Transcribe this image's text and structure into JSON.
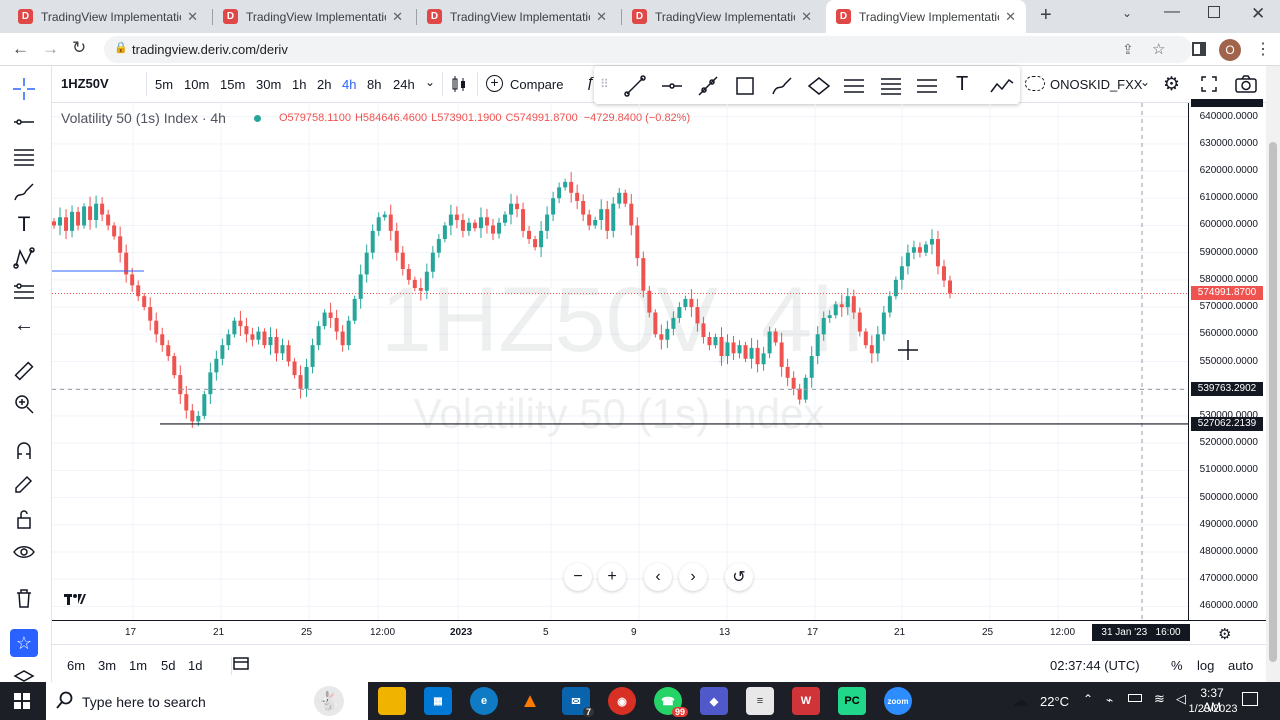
{
  "browser": {
    "tabs": [
      {
        "title": "TradingView Implementation"
      },
      {
        "title": "TradingView Implementation"
      },
      {
        "title": "TradingView Implementation"
      },
      {
        "title": "TradingView Implementation"
      },
      {
        "title": "TradingView Implementation"
      }
    ],
    "url": "tradingview.deriv.com/deriv",
    "profile_initial": "O"
  },
  "toolbar": {
    "symbol": "1HZ50V",
    "timeframes": [
      "5m",
      "10m",
      "15m",
      "30m",
      "1h",
      "2h",
      "4h",
      "8h",
      "24h"
    ],
    "active_timeframe": "4h",
    "compare_label": "Compare",
    "account_label": "ONOSKID_FXX"
  },
  "legend": {
    "title": "Volatility 50 (1s) Index · 4h",
    "open": "O579758.1100",
    "high": "H584646.4600",
    "low": "L573901.1900",
    "close": "C574991.8700",
    "change": "−4729.8400 (−0.82%)"
  },
  "watermark": {
    "symbol": "1HZ50V, 4h",
    "name": "Volatility 50 (1s) Index"
  },
  "yaxis": {
    "ticks": [
      "640000.0000",
      "630000.0000",
      "620000.0000",
      "610000.0000",
      "600000.0000",
      "590000.0000",
      "580000.0000",
      "570000.0000",
      "560000.0000",
      "550000.0000",
      "540000.0000",
      "530000.0000",
      "520000.0000",
      "510000.0000",
      "500000.0000",
      "490000.0000",
      "480000.0000",
      "470000.0000",
      "460000.0000"
    ],
    "price_label": "574991.8700",
    "crosshair_label": "539763.2902",
    "hline_label": "527062.2139"
  },
  "xaxis": {
    "ticks": [
      "17",
      "21",
      "25",
      "12:00",
      "2023",
      "5",
      "9",
      "13",
      "17",
      "21",
      "25",
      "12:00"
    ],
    "crosshair_label": "31 Jan '23   16:00"
  },
  "bottom": {
    "ranges": [
      "6m",
      "3m",
      "1m",
      "5d",
      "1d"
    ],
    "clock": "02:37:44 (UTC)",
    "pct": "%",
    "log": "log",
    "auto": "auto"
  },
  "taskbar": {
    "search_placeholder": "Type here to search",
    "weather": "22°C",
    "time": "3:37 AM",
    "date": "1/23/2023",
    "badges": {
      "mail": "7",
      "whatsapp": "99"
    }
  },
  "colors": {
    "up": "#26a69a",
    "down": "#ef5350",
    "accent": "#2962ff"
  },
  "chart_data": {
    "type": "candlestick",
    "timeframe": "4h",
    "price_range": [
      455000,
      645000
    ],
    "close_series": [
      600000,
      603000,
      598000,
      605000,
      600000,
      607000,
      602000,
      608000,
      604000,
      600000,
      596000,
      590000,
      582000,
      578000,
      574000,
      570000,
      565000,
      560000,
      556000,
      552000,
      545000,
      538000,
      532000,
      528000,
      530000,
      538000,
      546000,
      551000,
      556000,
      560000,
      565000,
      563000,
      560000,
      558000,
      561000,
      556000,
      559000,
      553000,
      556000,
      550000,
      545000,
      540000,
      548000,
      556000,
      563000,
      568000,
      566000,
      561000,
      556000,
      565000,
      573000,
      582000,
      590000,
      598000,
      603000,
      604000,
      598000,
      590000,
      584000,
      580000,
      577000,
      576000,
      583000,
      590000,
      595000,
      600000,
      604000,
      602000,
      598000,
      601000,
      599000,
      603000,
      600000,
      597000,
      601000,
      604000,
      608000,
      606000,
      598000,
      595000,
      592000,
      598000,
      604000,
      610000,
      614000,
      616000,
      612000,
      609000,
      604000,
      600000,
      602000,
      606000,
      598000,
      608000,
      612000,
      608000,
      600000,
      588000,
      576000,
      568000,
      560000,
      558000,
      562000,
      566000,
      570000,
      573000,
      570000,
      564000,
      559000,
      556000,
      559000,
      552000,
      557000,
      553000,
      556000,
      551000,
      555000,
      549000,
      553000,
      561000,
      557000,
      548000,
      544000,
      540000,
      536000,
      544000,
      552000,
      560000,
      566000,
      567000,
      571000,
      570000,
      574000,
      568000,
      561000,
      556000,
      553000,
      560000,
      568000,
      574000,
      580000,
      585000,
      590000,
      592000,
      590000,
      593000,
      595000,
      585000,
      579758,
      574992
    ],
    "horizontal_lines": [
      {
        "price": 527062.2139
      }
    ],
    "last_price": 574991.87
  }
}
